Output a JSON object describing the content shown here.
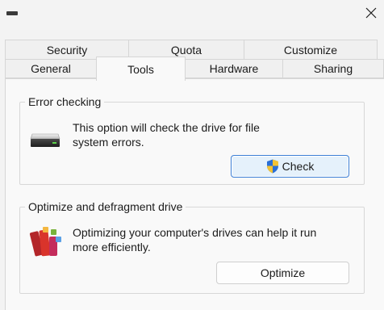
{
  "window": {
    "title_icon": "minus-icon",
    "close_icon": "close-icon"
  },
  "tabs": {
    "row1": [
      "Security",
      "Quota",
      "Customize"
    ],
    "row2": [
      "General",
      "Tools",
      "Hardware",
      "Sharing"
    ],
    "active": "Tools"
  },
  "error_checking": {
    "title": "Error checking",
    "description_line1": "This option will check the drive for file",
    "description_line2": "system errors.",
    "icon": "drive-icon",
    "button_label": "Check",
    "button_icon": "uac-shield-icon"
  },
  "optimize": {
    "title": "Optimize and defragment drive",
    "description_line1": "Optimizing your computer's drives can help it run",
    "description_line2": "more efficiently.",
    "icon": "defrag-icon",
    "button_label": "Optimize"
  },
  "colors": {
    "focus_border": "#3c7fd6",
    "focus_fill": "#e5f1fb"
  }
}
